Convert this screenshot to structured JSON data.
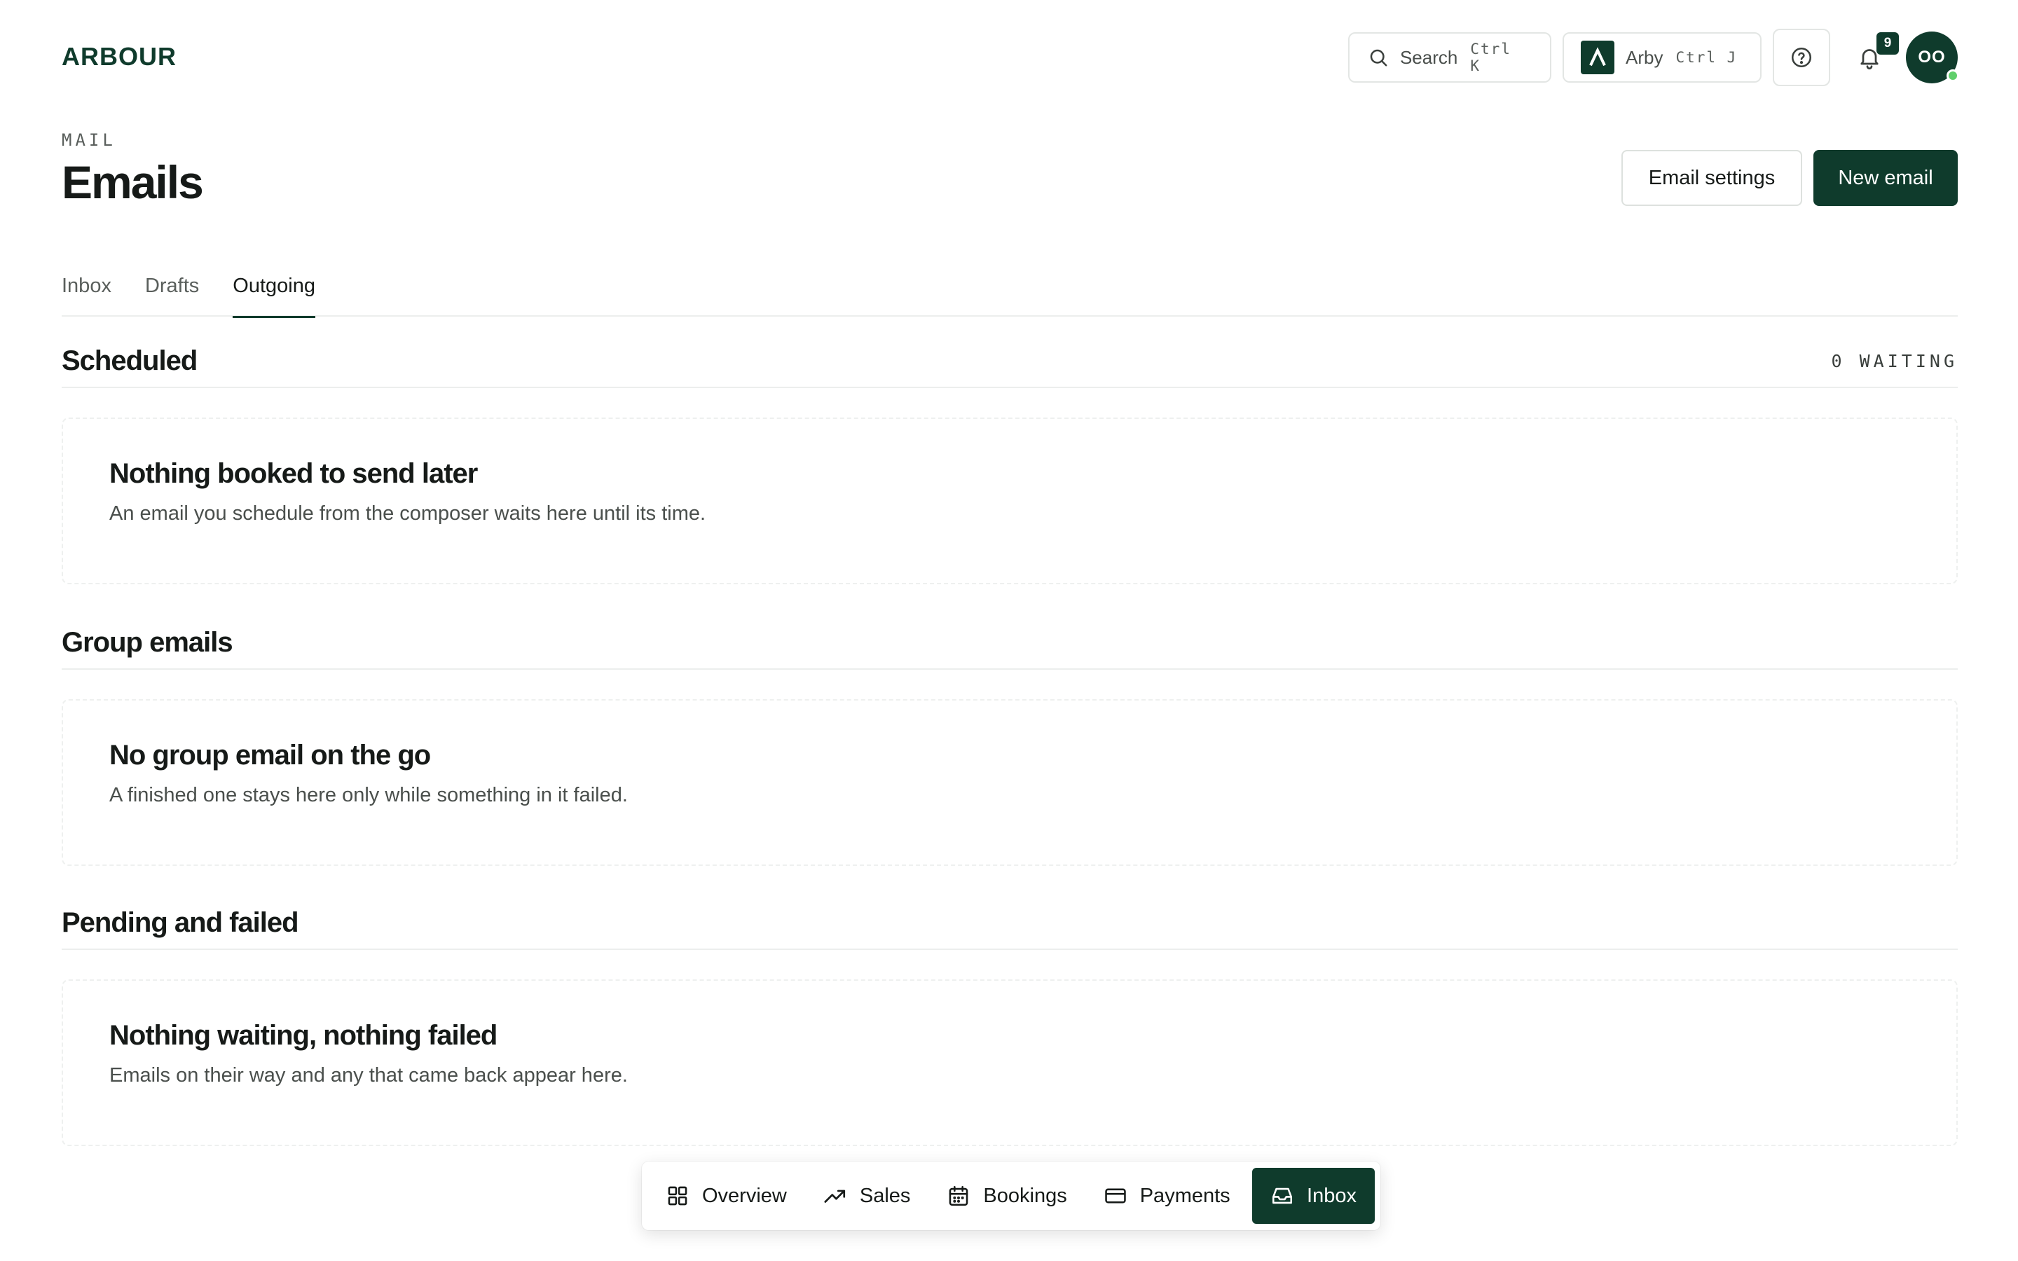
{
  "brand": {
    "name": "ARBOUR"
  },
  "topbar": {
    "search_label": "Search",
    "search_shortcut": "Ctrl K",
    "assistant_label": "Arby",
    "assistant_shortcut": "Ctrl J",
    "notification_count": "9",
    "avatar_initials": "OO"
  },
  "page": {
    "eyebrow": "MAIL",
    "title": "Emails",
    "actions": {
      "settings": "Email settings",
      "new": "New email"
    }
  },
  "tabs": [
    {
      "label": "Inbox",
      "active": false
    },
    {
      "label": "Drafts",
      "active": false
    },
    {
      "label": "Outgoing",
      "active": true
    }
  ],
  "sections": [
    {
      "title": "Scheduled",
      "meta": "0 WAITING",
      "empty_title": "Nothing booked to send later",
      "empty_desc": "An email you schedule from the composer waits here until its time."
    },
    {
      "title": "Group emails",
      "meta": "",
      "empty_title": "No group email on the go",
      "empty_desc": "A finished one stays here only while something in it failed."
    },
    {
      "title": "Pending and failed",
      "meta": "",
      "empty_title": "Nothing waiting, nothing failed",
      "empty_desc": "Emails on their way and any that came back appear here."
    }
  ],
  "dock": [
    {
      "label": "Overview",
      "icon": "grid-icon"
    },
    {
      "label": "Sales",
      "icon": "trend-up-icon"
    },
    {
      "label": "Bookings",
      "icon": "calendar-icon"
    },
    {
      "label": "Payments",
      "icon": "card-icon"
    },
    {
      "label": "Inbox",
      "icon": "inbox-icon",
      "active": true
    }
  ],
  "colors": {
    "brand": "#0f3b2c",
    "online": "#5fcf6b",
    "border": "#e3e6e4"
  }
}
